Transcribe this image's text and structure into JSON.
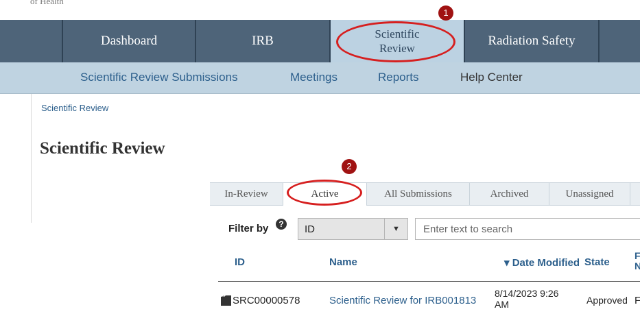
{
  "org_text_clipped": "of Health",
  "main_nav": {
    "tabs": [
      {
        "label": "Dashboard"
      },
      {
        "label": "IRB"
      },
      {
        "label": "Scientific Review"
      },
      {
        "label": "Radiation Safety"
      }
    ],
    "active": "Scientific Review"
  },
  "sub_nav": {
    "links": [
      {
        "label": "Scientific Review Submissions"
      },
      {
        "label": "Meetings"
      },
      {
        "label": "Reports"
      },
      {
        "label": "Help Center"
      }
    ]
  },
  "breadcrumb": "Scientific Review",
  "page_title": "Scientific Review",
  "view_tabs": {
    "items": [
      {
        "label": "In-Review"
      },
      {
        "label": "Active"
      },
      {
        "label": "All Submissions"
      },
      {
        "label": "Archived"
      },
      {
        "label": "Unassigned"
      }
    ],
    "active": "Active"
  },
  "filter": {
    "label": "Filter by",
    "help_icon": "question-circle-icon",
    "field_value": "ID",
    "dropdown_icon": "caret-down-icon",
    "search_placeholder": "Enter text to search"
  },
  "table": {
    "columns": [
      {
        "label": "ID"
      },
      {
        "label": "Name"
      },
      {
        "label": "▾ Date Modified"
      },
      {
        "label": "State"
      },
      {
        "label": "F N"
      }
    ],
    "rows": [
      {
        "icon": "document-icon",
        "id": "SRC00000578",
        "name": "Scientific Review for IRB001813",
        "date_line1": "8/14/2023 9:26",
        "date_line2": "AM",
        "state": "Approved",
        "clipped": "F"
      }
    ]
  },
  "annotations": [
    {
      "number": "1",
      "target": "Scientific Review nav tab"
    },
    {
      "number": "2",
      "target": "Active tab"
    }
  ],
  "colors": {
    "nav_bg": "#4e6479",
    "nav_active_bg": "#bcd2e2",
    "subnav_bg": "#bfd3e1",
    "link": "#2c5f8c",
    "annotation_red": "#d61f1f",
    "badge_red": "#a01212"
  }
}
